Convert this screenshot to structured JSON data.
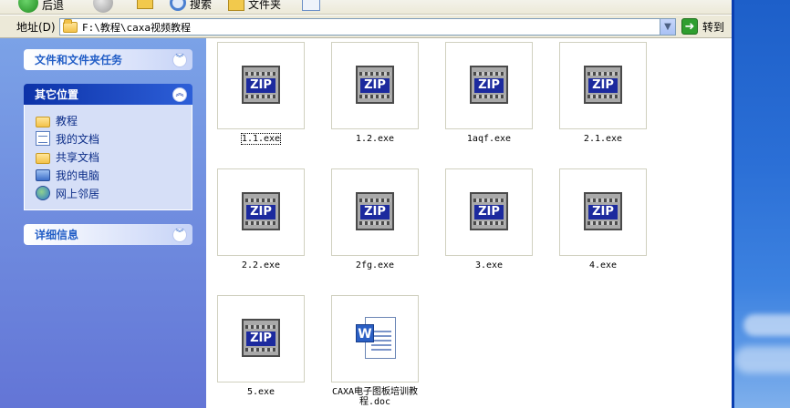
{
  "toolbar": {
    "back_label": "后退",
    "search_label": "搜索",
    "folders_label": "文件夹"
  },
  "address_bar": {
    "label": "地址(D)",
    "value": "F:\\教程\\caxa视频教程",
    "go_label": "转到"
  },
  "task_pane": {
    "file_tasks_title": "文件和文件夹任务",
    "other_places_title": "其它位置",
    "other_places": [
      {
        "label": "教程",
        "icon": "folder-icon"
      },
      {
        "label": "我的文档",
        "icon": "my-documents-icon"
      },
      {
        "label": "共享文档",
        "icon": "folder-icon"
      },
      {
        "label": "我的电脑",
        "icon": "my-computer-icon"
      },
      {
        "label": "网上邻居",
        "icon": "network-icon"
      }
    ],
    "details_title": "详细信息"
  },
  "files": [
    {
      "name": "1.1.exe",
      "type": "zip-exe",
      "selected": true
    },
    {
      "name": "1.2.exe",
      "type": "zip-exe"
    },
    {
      "name": "1aqf.exe",
      "type": "zip-exe"
    },
    {
      "name": "2.1.exe",
      "type": "zip-exe"
    },
    {
      "name": "2.2.exe",
      "type": "zip-exe"
    },
    {
      "name": "2fg.exe",
      "type": "zip-exe"
    },
    {
      "name": "3.exe",
      "type": "zip-exe"
    },
    {
      "name": "4.exe",
      "type": "zip-exe"
    },
    {
      "name": "5.exe",
      "type": "zip-exe"
    },
    {
      "name": "CAXA电子图板培训教程.doc",
      "type": "word-doc"
    }
  ],
  "icons": {
    "zip_text": "ZIP",
    "word_letter": "W"
  },
  "colors": {
    "taskpane_top": "#7ba2e7",
    "taskpane_bottom": "#6375d6",
    "panel_head_dark": "#0c32a8",
    "link_text": "#0c2d88"
  }
}
